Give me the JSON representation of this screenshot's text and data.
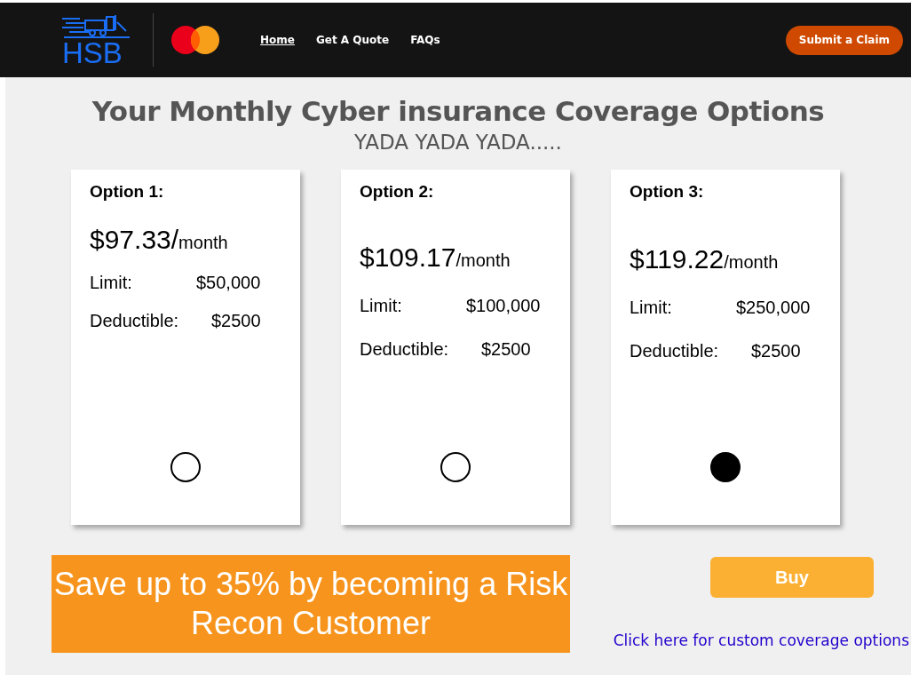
{
  "header": {
    "logo_text": "HSB",
    "nav": [
      {
        "label": "Home",
        "selected": true
      },
      {
        "label": "Get A Quote",
        "selected": false
      },
      {
        "label": "FAQs",
        "selected": false
      }
    ],
    "action_button": "Submit a Claim"
  },
  "title": "Your Monthly Cyber insurance Coverage Options",
  "subtitle": "YADA YADA YADA.....",
  "options": [
    {
      "title": "Option 1:",
      "price": "$97.33/",
      "unit": "month",
      "limit_label": "Limit:",
      "limit": "$50,000",
      "deductible_label": "Deductible:",
      "deductible": "$2500",
      "selected": false
    },
    {
      "title": "Option 2:",
      "price": "$109.17",
      "unit": "/month",
      "limit_label": "Limit:",
      "limit": "$100,000",
      "deductible_label": "Deductible:",
      "deductible": "$2500",
      "selected": false
    },
    {
      "title": "Option 3:",
      "price": "$119.22",
      "unit": "/month",
      "limit_label": "Limit:",
      "limit": "$250,000",
      "deductible_label": "Deductible:",
      "deductible": "$2500",
      "selected": true
    }
  ],
  "promo": "Save up to 35% by becoming a Risk Recon Customer",
  "buy_button": "Buy",
  "custom_link": "Click here for custom coverage options"
}
